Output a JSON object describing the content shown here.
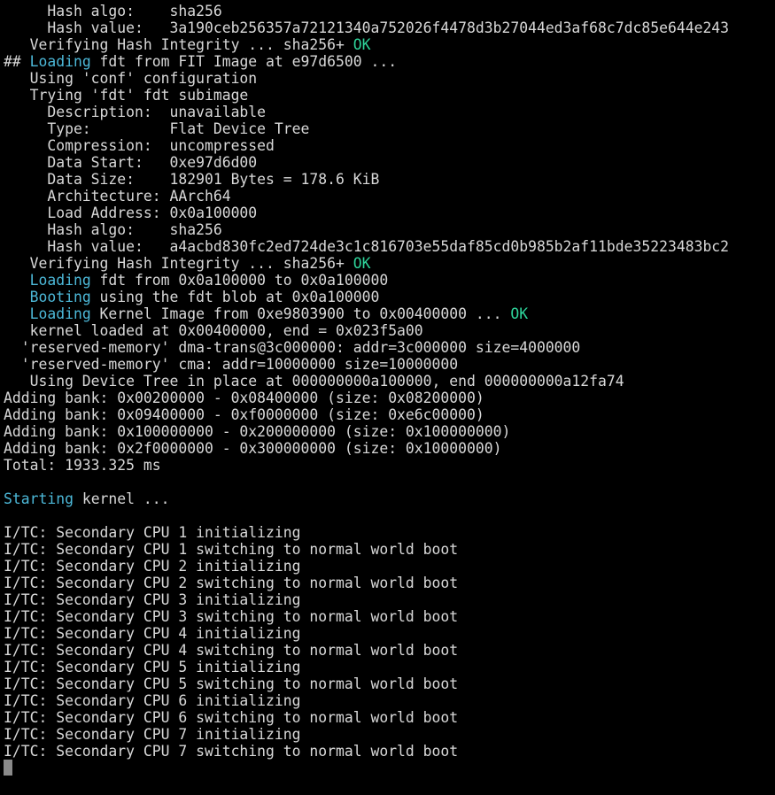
{
  "colors": {
    "background": "#000000",
    "text": "#d8d8d8",
    "highlight": "#4cb8d8",
    "ok": "#2ed39a",
    "cursor": "#8a8a8a"
  },
  "terminal": {
    "lines": [
      [
        {
          "t": "     Hash algo:    sha256"
        }
      ],
      [
        {
          "t": "     Hash value:   3a190ceb256357a72121340a752026f4478d3b27044ed3af68c7dc85e644e243"
        }
      ],
      [
        {
          "t": "   Verifying Hash Integrity ... sha256+ "
        },
        {
          "t": "OK",
          "c": "ok"
        }
      ],
      [
        {
          "t": "## "
        },
        {
          "t": "Loading",
          "c": "hl"
        },
        {
          "t": " fdt from FIT Image at e97d6500 ..."
        }
      ],
      [
        {
          "t": "   Using 'conf' configuration"
        }
      ],
      [
        {
          "t": "   Trying 'fdt' fdt subimage"
        }
      ],
      [
        {
          "t": "     Description:  unavailable"
        }
      ],
      [
        {
          "t": "     Type:         Flat Device Tree"
        }
      ],
      [
        {
          "t": "     Compression:  uncompressed"
        }
      ],
      [
        {
          "t": "     Data Start:   0xe97d6d00"
        }
      ],
      [
        {
          "t": "     Data Size:    182901 Bytes = 178.6 KiB"
        }
      ],
      [
        {
          "t": "     Architecture: AArch64"
        }
      ],
      [
        {
          "t": "     Load Address: 0x0a100000"
        }
      ],
      [
        {
          "t": "     Hash algo:    sha256"
        }
      ],
      [
        {
          "t": "     Hash value:   a4acbd830fc2ed724de3c1c816703e55daf85cd0b985b2af11bde35223483bc2"
        }
      ],
      [
        {
          "t": "   Verifying Hash Integrity ... sha256+ "
        },
        {
          "t": "OK",
          "c": "ok"
        }
      ],
      [
        {
          "t": "   "
        },
        {
          "t": "Loading",
          "c": "hl"
        },
        {
          "t": " fdt from 0x0a100000 to 0x0a100000"
        }
      ],
      [
        {
          "t": "   "
        },
        {
          "t": "Booting",
          "c": "hl"
        },
        {
          "t": " using the fdt blob at 0x0a100000"
        }
      ],
      [
        {
          "t": "   "
        },
        {
          "t": "Loading",
          "c": "hl"
        },
        {
          "t": " Kernel Image from 0xe9803900 to 0x00400000 ... "
        },
        {
          "t": "OK",
          "c": "ok"
        }
      ],
      [
        {
          "t": "   kernel loaded at 0x00400000, end = 0x023f5a00"
        }
      ],
      [
        {
          "t": "  'reserved-memory' dma-trans@3c000000: addr=3c000000 size=4000000"
        }
      ],
      [
        {
          "t": "  'reserved-memory' cma: addr=10000000 size=10000000"
        }
      ],
      [
        {
          "t": "   Using Device Tree in place at 000000000a100000, end 000000000a12fa74"
        }
      ],
      [
        {
          "t": "Adding bank: 0x00200000 - 0x08400000 (size: 0x08200000)"
        }
      ],
      [
        {
          "t": "Adding bank: 0x09400000 - 0xf0000000 (size: 0xe6c00000)"
        }
      ],
      [
        {
          "t": "Adding bank: 0x100000000 - 0x200000000 (size: 0x100000000)"
        }
      ],
      [
        {
          "t": "Adding bank: 0x2f0000000 - 0x300000000 (size: 0x10000000)"
        }
      ],
      [
        {
          "t": "Total: 1933.325 ms"
        }
      ],
      [
        {
          "t": ""
        }
      ],
      [
        {
          "t": "Starting",
          "c": "hl"
        },
        {
          "t": " kernel ..."
        }
      ],
      [
        {
          "t": ""
        }
      ],
      [
        {
          "t": "I/TC: Secondary CPU 1 initializing"
        }
      ],
      [
        {
          "t": "I/TC: Secondary CPU 1 switching to normal world boot"
        }
      ],
      [
        {
          "t": "I/TC: Secondary CPU 2 initializing"
        }
      ],
      [
        {
          "t": "I/TC: Secondary CPU 2 switching to normal world boot"
        }
      ],
      [
        {
          "t": "I/TC: Secondary CPU 3 initializing"
        }
      ],
      [
        {
          "t": "I/TC: Secondary CPU 3 switching to normal world boot"
        }
      ],
      [
        {
          "t": "I/TC: Secondary CPU 4 initializing"
        }
      ],
      [
        {
          "t": "I/TC: Secondary CPU 4 switching to normal world boot"
        }
      ],
      [
        {
          "t": "I/TC: Secondary CPU 5 initializing"
        }
      ],
      [
        {
          "t": "I/TC: Secondary CPU 5 switching to normal world boot"
        }
      ],
      [
        {
          "t": "I/TC: Secondary CPU 6 initializing"
        }
      ],
      [
        {
          "t": "I/TC: Secondary CPU 6 switching to normal world boot"
        }
      ],
      [
        {
          "t": "I/TC: Secondary CPU 7 initializing"
        }
      ],
      [
        {
          "t": "I/TC: Secondary CPU 7 switching to normal world boot"
        }
      ]
    ]
  }
}
